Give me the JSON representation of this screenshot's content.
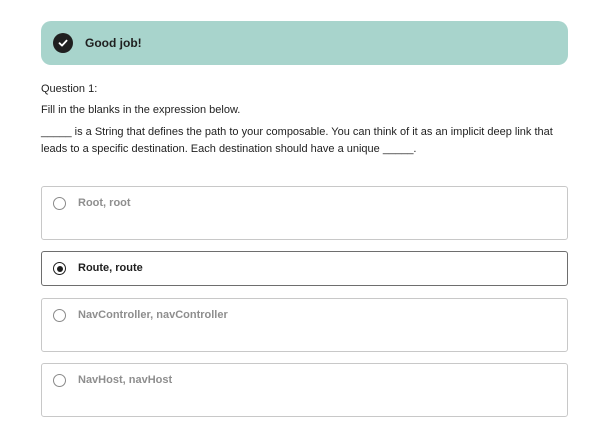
{
  "banner": {
    "icon": "check-circle-icon",
    "text": "Good job!",
    "background": "#a8d4cc"
  },
  "question": {
    "label": "Question 1:",
    "instruction": "Fill in the blanks in the expression below.",
    "text": "_____ is a String that defines the path to your composable. You can think of it as an implicit deep link that leads to a specific destination. Each destination should have a unique _____."
  },
  "options": [
    {
      "label": "Root, root",
      "selected": false
    },
    {
      "label": "Route, route",
      "selected": true
    },
    {
      "label": "NavController, navController",
      "selected": false
    },
    {
      "label": "NavHost, navHost",
      "selected": false
    }
  ]
}
